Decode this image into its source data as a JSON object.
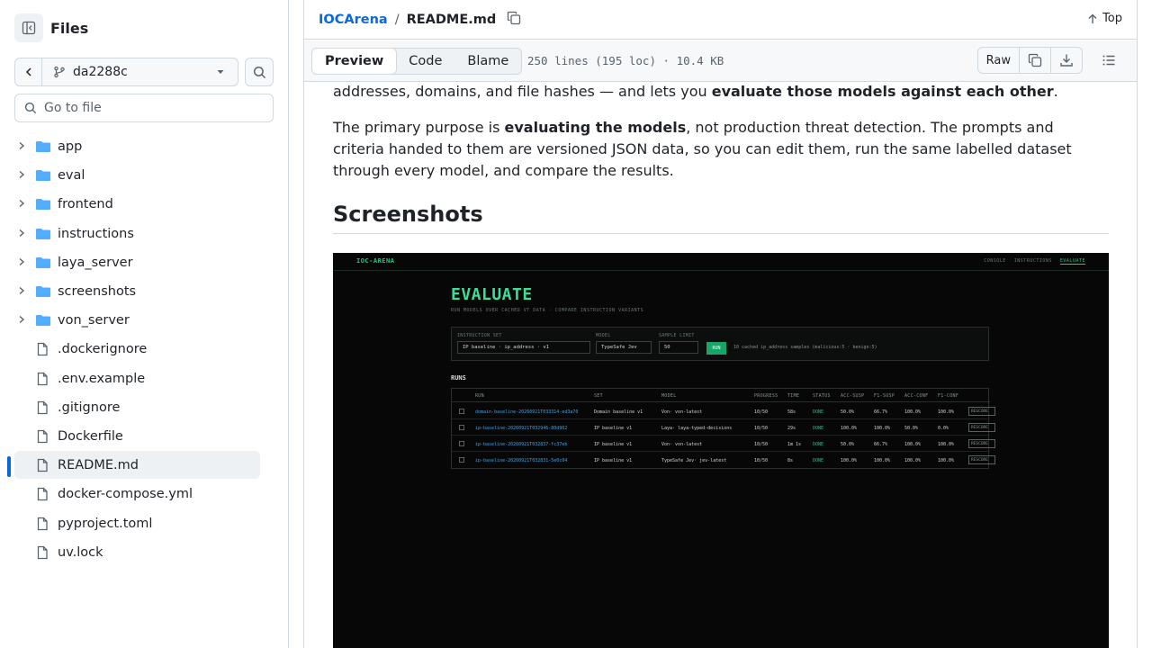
{
  "sidebar": {
    "title": "Files",
    "branch": "da2288c",
    "goto_placeholder": "Go to file",
    "items": [
      {
        "label": "app",
        "type": "folder"
      },
      {
        "label": "eval",
        "type": "folder"
      },
      {
        "label": "frontend",
        "type": "folder"
      },
      {
        "label": "instructions",
        "type": "folder"
      },
      {
        "label": "laya_server",
        "type": "folder"
      },
      {
        "label": "screenshots",
        "type": "folder"
      },
      {
        "label": "von_server",
        "type": "folder"
      },
      {
        "label": ".dockerignore",
        "type": "file"
      },
      {
        "label": ".env.example",
        "type": "file"
      },
      {
        "label": ".gitignore",
        "type": "file"
      },
      {
        "label": "Dockerfile",
        "type": "file"
      },
      {
        "label": "README.md",
        "type": "file",
        "active": true
      },
      {
        "label": "docker-compose.yml",
        "type": "file"
      },
      {
        "label": "pyproject.toml",
        "type": "file"
      },
      {
        "label": "uv.lock",
        "type": "file"
      }
    ]
  },
  "header": {
    "repo": "IOCArena",
    "sep": "/",
    "file": "README.md",
    "top_link": "Top"
  },
  "toolbar": {
    "tabs": [
      "Preview",
      "Code",
      "Blame"
    ],
    "active_tab": "Preview",
    "meta": "250 lines (195 loc) · 10.4 KB",
    "raw": "Raw"
  },
  "content": {
    "p1_prefix": "addresses, domains, and file hashes — and lets you ",
    "p1_bold": "evaluate those models against each other",
    "p1_suffix": ".",
    "p2_prefix": "The primary purpose is ",
    "p2_bold": "evaluating the models",
    "p2_suffix": ", not production threat detection. The prompts and criteria handed to them are versioned JSON data, so you can edit them, run the same labelled dataset through every model, and compare the results.",
    "heading": "Screenshots"
  },
  "embedded": {
    "logo": "IOC-ARENA",
    "nav": [
      "CONSOLE",
      "INSTRUCTIONS",
      "EVALUATE"
    ],
    "nav_active": "EVALUATE",
    "title": "EVALUATE",
    "subtitle": "RUN MODELS OVER CACHED VT DATA · COMPARE INSTRUCTION VARIANTS",
    "labels": {
      "instruction_set": "INSTRUCTION SET",
      "model": "MODEL",
      "sample_limit": "SAMPLE LIMIT"
    },
    "instruction_value": "IP baseline · ip_address · v1",
    "model_value": "TypeSafe Jev",
    "sample_value": "50",
    "run_label": "RUN",
    "cache_note": "10 cached ip_address samples (malicious:5 · benign:5)",
    "runs_heading": "RUNS",
    "columns": [
      "RUN",
      "SET",
      "MODEL",
      "PROGRESS",
      "TIME",
      "STATUS",
      "ACC-SUSP",
      "F1-SUSP",
      "ACC-CONF",
      "F1-CONF"
    ],
    "rows": [
      {
        "run": "domain-baseline-20260921T033314-ed3a70",
        "set": "Domain baseline v1",
        "model": "Von· von-latest",
        "progress": "10/50",
        "time": "58s",
        "status": "DONE",
        "acc_susp": "50.0%",
        "f1_susp": "66.7%",
        "acc_conf": "100.0%",
        "f1_conf": "100.0%",
        "action": "RESCORE"
      },
      {
        "run": "ip-baseline-20260921T032946-80d962",
        "set": "IP baseline v1",
        "model": "Laya· laya-typed-decisions",
        "progress": "10/50",
        "time": "29s",
        "status": "DONE",
        "acc_susp": "100.0%",
        "f1_susp": "100.0%",
        "acc_conf": "50.0%",
        "f1_conf": "0.0%",
        "action": "RESCORE"
      },
      {
        "run": "ip-baseline-20260921T032837-fc37eb",
        "set": "IP baseline v1",
        "model": "Von· von-latest",
        "progress": "10/50",
        "time": "1m 1s",
        "status": "DONE",
        "acc_susp": "50.0%",
        "f1_susp": "66.7%",
        "acc_conf": "100.0%",
        "f1_conf": "100.0%",
        "action": "RESCORE"
      },
      {
        "run": "ip-baseline-20260921T032831-5e0c04",
        "set": "IP baseline v1",
        "model": "TypeSafe Jev· jev-latest",
        "progress": "10/50",
        "time": "8s",
        "status": "DONE",
        "acc_susp": "100.0%",
        "f1_susp": "100.0%",
        "acc_conf": "100.0%",
        "f1_conf": "100.0%",
        "action": "RESCORE"
      }
    ]
  },
  "colors": {
    "accent": "#0969da",
    "active_bg": "#eef1f4",
    "folder": "#54aeff",
    "terminal_green": "#3ddc97"
  }
}
